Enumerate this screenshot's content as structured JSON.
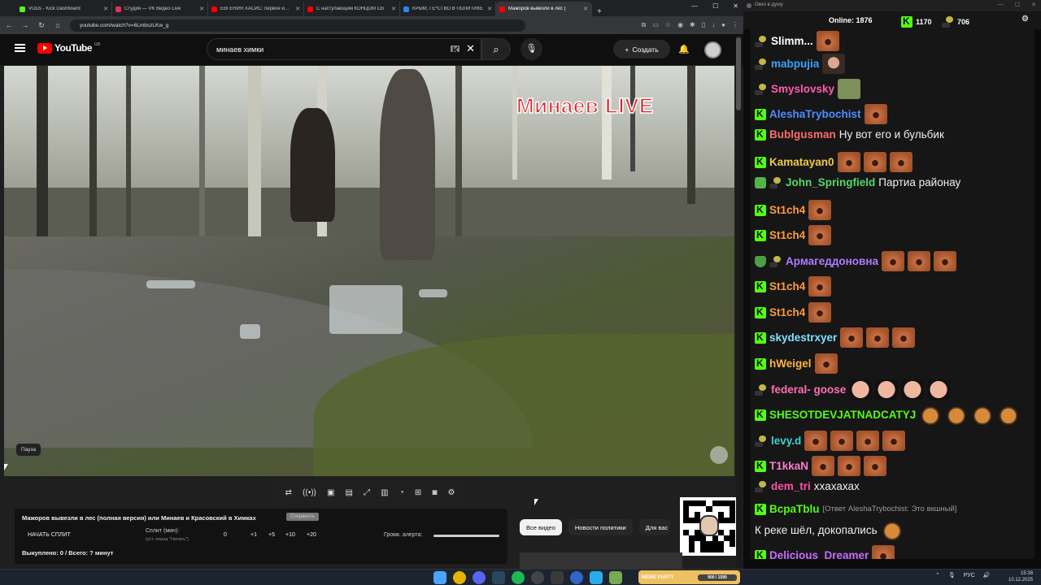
{
  "browser": {
    "tabs": [
      {
        "title": "VODs - Kick Dashboard",
        "color": "#53fc18",
        "active": false
      },
      {
        "title": "Студия — VK Видео Live",
        "color": "#e0335f",
        "active": false
      },
      {
        "title": "ЕВГЕНИЯ ХАСИС: первое инте",
        "color": "#ff0000",
        "active": false
      },
      {
        "title": "С наступающим КОНЦОМ СВ",
        "color": "#ff0000",
        "active": false
      },
      {
        "title": "КРЫМ, ГЕ*СТВО В ПОЛИТИКЕ",
        "color": "#2787f5",
        "active": false
      },
      {
        "title": "Мажоров вывезли в лес (",
        "color": "#ff0000",
        "active": true
      }
    ],
    "new_tab": "+",
    "url": "youtube.com/watch?v=6LmbszLKw_g"
  },
  "youtube": {
    "logo_text": "YouTube",
    "region": "GB",
    "search_value": "минаев химки",
    "create_label": "Создать"
  },
  "video": {
    "overlay_text": "Минаев LIVE",
    "pause_tooltip": "Пауза"
  },
  "panel": {
    "title": "Мажоров вывезли в лес (полная версия) или Минаев и Красовский в Химках",
    "save_label": "Сохранить",
    "split_button": "НАЧАТЬ СПЛИТ",
    "split_minutes_label": "Сплит (мин):",
    "split_hint": "(уст. перед \"Начать\")",
    "split_value": "0",
    "increments": [
      "+1",
      "+5",
      "+10",
      "+20"
    ],
    "alert_volume_label": "Громк. алерта:",
    "alert_volume_level": 1.0,
    "stats": "Выкуплено: 0 / Всего: ? минут"
  },
  "chips": [
    "Все видео",
    "Новости политики",
    "Для вас"
  ],
  "chat": {
    "window_title": "Окно в душу",
    "online_label": "Online:",
    "online_count": "1876",
    "kick_count": "1170",
    "other_count": "706",
    "messages": [
      {
        "badges": [
          "duck"
        ],
        "user": "Slimm...",
        "color": "#ffffff",
        "text": "",
        "emotes": [
          "em"
        ],
        "reply": ""
      },
      {
        "badges": [
          "duck"
        ],
        "user": "mabpujia",
        "color": "#3aa0ff",
        "text": "",
        "emotes": [
          "man"
        ],
        "reply": ""
      },
      {
        "badges": [
          "duck"
        ],
        "user": "Smyslovsky",
        "color": "#ff5ab0",
        "text": "",
        "emotes": [
          "green"
        ],
        "reply": ""
      },
      {
        "badges": [
          "kick"
        ],
        "user": "AleshaTrybochist",
        "color": "#4e8cff",
        "text": "",
        "emotes": [
          "em"
        ],
        "reply": ""
      },
      {
        "badges": [
          "kick"
        ],
        "user": "Bublgusman",
        "color": "#ff6b6b",
        "text": "Ну вот его и бульбик",
        "emotes": [],
        "reply": ""
      },
      {
        "badges": [
          "kick"
        ],
        "user": "Kamatayan0",
        "color": "#f5c84a",
        "text": "",
        "emotes": [
          "em",
          "em",
          "em"
        ],
        "reply": ""
      },
      {
        "badges": [
          "vip",
          "duck"
        ],
        "user": "John_Springfield",
        "color": "#53d86a",
        "text": "Партиа районау",
        "emotes": [],
        "reply": ""
      },
      {
        "badges": [
          "kick"
        ],
        "user": "St1ch4",
        "color": "#ff9a3c",
        "text": "",
        "emotes": [
          "em"
        ],
        "reply": ""
      },
      {
        "badges": [
          "kick"
        ],
        "user": "St1ch4",
        "color": "#ff9a3c",
        "text": "",
        "emotes": [
          "em"
        ],
        "reply": ""
      },
      {
        "badges": [
          "shield",
          "duck"
        ],
        "user": "Армагеддоновна",
        "color": "#b07bff",
        "text": "",
        "emotes": [
          "em",
          "em",
          "em"
        ],
        "reply": ""
      },
      {
        "badges": [
          "kick"
        ],
        "user": "St1ch4",
        "color": "#ff9a3c",
        "text": "",
        "emotes": [
          "em"
        ],
        "reply": ""
      },
      {
        "badges": [
          "kick"
        ],
        "user": "St1ch4",
        "color": "#ff9a3c",
        "text": "",
        "emotes": [
          "em"
        ],
        "reply": ""
      },
      {
        "badges": [
          "kick"
        ],
        "user": "skydestrxyer",
        "color": "#7ee0ff",
        "text": "",
        "emotes": [
          "em",
          "em",
          "em"
        ],
        "reply": ""
      },
      {
        "badges": [
          "kick"
        ],
        "user": "hWeigel",
        "color": "#ffb347",
        "text": "",
        "emotes": [
          "em"
        ],
        "reply": ""
      },
      {
        "badges": [
          "duck"
        ],
        "user": "federal- goose",
        "color": "#ff6fb5",
        "text": "",
        "emotes": [
          "bald",
          "bald",
          "bald",
          "bald"
        ],
        "reply": ""
      },
      {
        "badges": [
          "kick"
        ],
        "user": "SHESOTDEVJATNADCATYJ",
        "color": "#53fc18",
        "text": "",
        "emotes": [
          "jerry",
          "jerry",
          "jerry",
          "jerry"
        ],
        "reply": ""
      },
      {
        "badges": [
          "duck"
        ],
        "user": "levy.d",
        "color": "#3fd0d0",
        "text": "",
        "emotes": [
          "em",
          "em",
          "em",
          "em"
        ],
        "reply": ""
      },
      {
        "badges": [
          "kick"
        ],
        "user": "T1kkaN",
        "color": "#ff7bd0",
        "text": "",
        "emotes": [
          "em",
          "em",
          "em"
        ],
        "reply": ""
      },
      {
        "badges": [
          "duck"
        ],
        "user": "dem_tri",
        "color": "#ff4fa8",
        "text": "хxахахах",
        "emotes": [],
        "reply": ""
      },
      {
        "badges": [
          "kick"
        ],
        "user": "BcpaTblu",
        "color": "#53fc18",
        "text": "",
        "emotes": [],
        "reply": "[Ответ AleshaTrybochist: Это вкшный]"
      },
      {
        "badges": [],
        "user": "",
        "color": "#ffffff",
        "text": "К реке шёл, докопались",
        "emotes": [
          "jerry"
        ],
        "reply": ""
      },
      {
        "badges": [
          "kick"
        ],
        "user": "Delicious_Dreamer",
        "color": "#c86bff",
        "text": "",
        "emotes": [
          "em"
        ],
        "reply": ""
      }
    ]
  },
  "taskbar": {
    "meme_label": "MEME PARTY",
    "meme_progress": "900 / 1590",
    "lang": "РУС",
    "time": "15:38",
    "date": "10.12.2025"
  }
}
